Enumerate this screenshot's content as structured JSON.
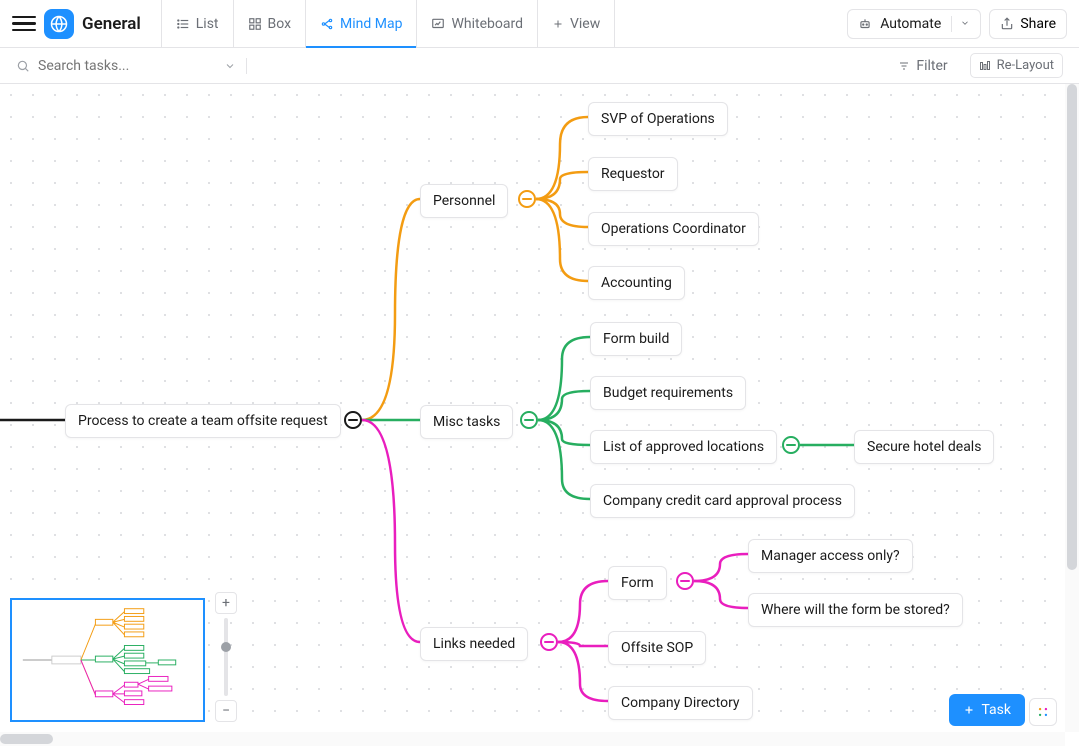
{
  "header": {
    "workspace": "General",
    "tabs": {
      "list": "List",
      "box": "Box",
      "mindmap": "Mind Map",
      "whiteboard": "Whiteboard",
      "view": "View"
    },
    "automate": "Automate",
    "share": "Share"
  },
  "subheader": {
    "search_placeholder": "Search tasks...",
    "filter": "Filter",
    "relayout": "Re-Layout"
  },
  "mindmap": {
    "root": "Process to create a team offsite request",
    "branch1": {
      "label": "Personnel",
      "color": "#f39c12",
      "children": [
        "SVP of Operations",
        "Requestor",
        "Operations Coordinator",
        "Accounting"
      ]
    },
    "branch2": {
      "label": "Misc tasks",
      "color": "#27ae60",
      "children": [
        "Form build",
        "Budget requirements",
        "List of approved locations",
        "Company credit card approval process"
      ],
      "grandchild": "Secure hotel deals"
    },
    "branch3": {
      "label": "Links needed",
      "color": "#e91ebe",
      "children": [
        "Form",
        "Offsite SOP",
        "Company Directory"
      ],
      "grandchildren": [
        "Manager access only?",
        "Where will the form be stored?"
      ]
    }
  },
  "footer": {
    "task": "Task"
  }
}
